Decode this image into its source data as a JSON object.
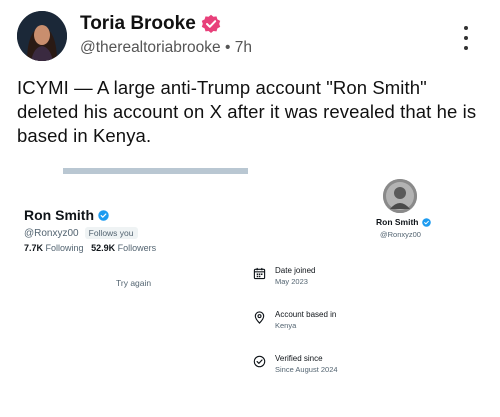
{
  "post": {
    "author_name": "Toria Brooke",
    "handle": "@therealtoriabrooke",
    "separator": "•",
    "time": "7h",
    "text": "ICYMI — A large anti-Trump account \"Ron Smith\" deleted his account on X after it was revealed that he is based in Kenya."
  },
  "screenshot": {
    "left_profile": {
      "name": "Ron Smith",
      "handle": "@Ronxyz00",
      "follows_you": "Follows you",
      "following_count": "7.7K",
      "following_label": "Following",
      "followers_count": "52.9K",
      "followers_label": "Followers",
      "try_again": "Try again"
    },
    "right_profile": {
      "name": "Ron Smith",
      "handle": "@Ronxyz00"
    },
    "info_items": [
      {
        "icon": "calendar-icon",
        "title": "Date joined",
        "value": "May 2023"
      },
      {
        "icon": "location-pin-icon",
        "title": "Account based in",
        "value": "Kenya"
      },
      {
        "icon": "verified-check-icon",
        "title": "Verified since",
        "value": "Since August 2024"
      }
    ]
  },
  "colors": {
    "verified_pink": "#e8407a",
    "verified_blue": "#1d9bf0",
    "header_bar": "#b9c7d2"
  }
}
